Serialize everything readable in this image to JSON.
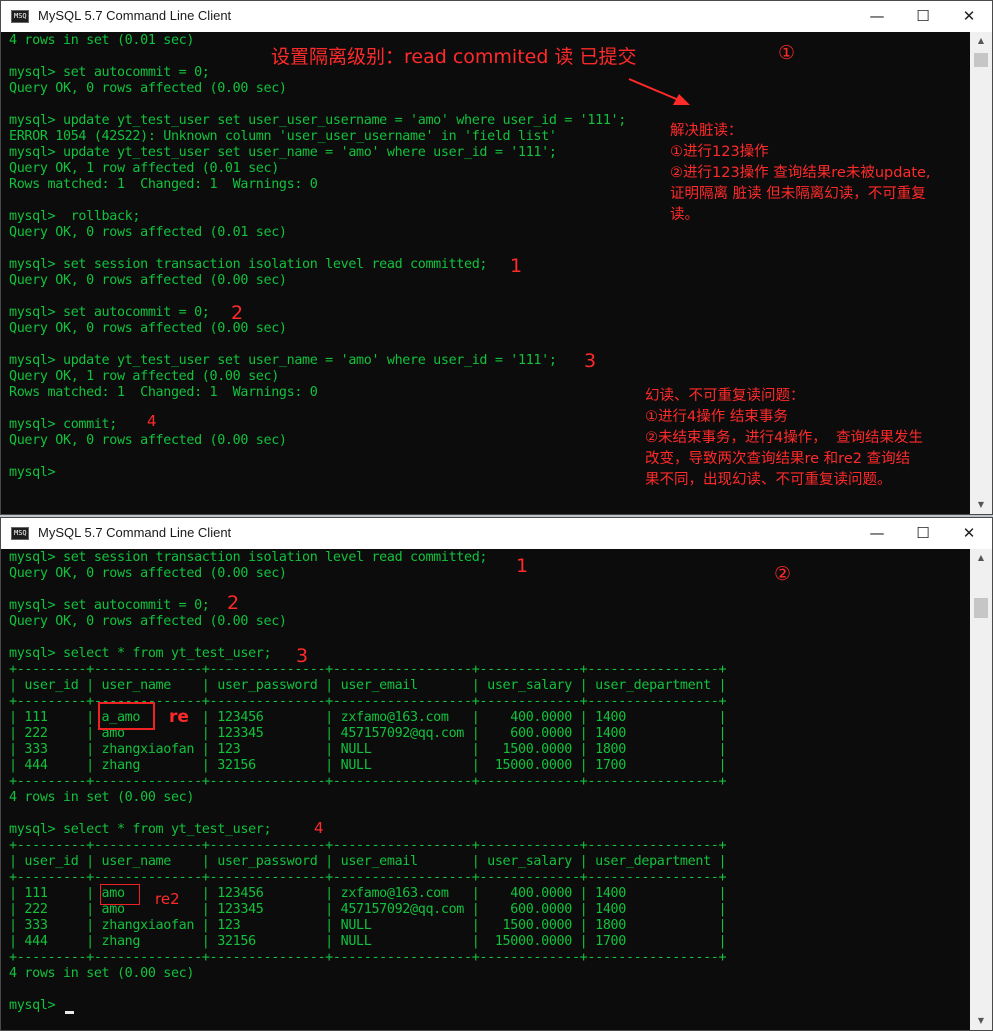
{
  "colors": {
    "terminal_bg": "#0c0c0c",
    "terminal_text": "#13c13c",
    "annotation": "#ff2a2a"
  },
  "window1": {
    "title": "MySQL 5.7 Command Line Client",
    "icon": "mysql-console-icon",
    "icon_text": "MSQ",
    "lines": [
      "4 rows in set (0.01 sec)",
      "",
      "mysql> set autocommit = 0;",
      "Query OK, 0 rows affected (0.00 sec)",
      "",
      "mysql> update yt_test_user set user_user_username = 'amo' where user_id = '111';",
      "ERROR 1054 (42S22): Unknown column 'user_user_username' in 'field list'",
      "mysql> update yt_test_user set user_name = 'amo' where user_id = '111';",
      "Query OK, 1 row affected (0.01 sec)",
      "Rows matched: 1  Changed: 1  Warnings: 0",
      "",
      "mysql>  rollback;",
      "Query OK, 0 rows affected (0.01 sec)",
      "",
      "mysql> set session transaction isolation level read committed;",
      "Query OK, 0 rows affected (0.00 sec)",
      "",
      "mysql> set autocommit = 0;",
      "Query OK, 0 rows affected (0.00 sec)",
      "",
      "mysql> update yt_test_user set user_name = 'amo' where user_id = '111';",
      "Query OK, 1 row affected (0.00 sec)",
      "Rows matched: 1  Changed: 1  Warnings: 0",
      "",
      "mysql> commit;",
      "Query OK, 0 rows affected (0.00 sec)",
      "",
      "mysql>"
    ],
    "heading": "设置隔离级别：read commited 读 已提交",
    "circle_label": "①",
    "note_dirty": "解决脏读：\n①进行123操作\n②进行123操作 查询结果re未被update,\n证明隔离 脏读 但未隔离幻读，不可重复\n读。",
    "note_phantom": "幻读、不可重复读问题：\n①进行4操作 结束事务\n②未结束事务，进行4操作，  查询结果发生\n改变，导致两次查询结果re 和re2 查询结\n果不同，出现幻读、不可重复读问题。",
    "step_1": "1",
    "step_2": "2",
    "step_3": "3",
    "step_4": "4"
  },
  "window2": {
    "title": "MySQL 5.7 Command Line Client",
    "icon": "mysql-console-icon",
    "icon_text": "MSQ",
    "lines": [
      "mysql> set session transaction isolation level read committed;",
      "Query OK, 0 rows affected (0.00 sec)",
      "",
      "mysql> set autocommit = 0;",
      "Query OK, 0 rows affected (0.00 sec)",
      "",
      "mysql> select * from yt_test_user;",
      "+---------+--------------+---------------+------------------+-------------+-----------------+",
      "| user_id | user_name    | user_password | user_email       | user_salary | user_department |",
      "+---------+--------------+---------------+------------------+-------------+-----------------+",
      "| 111     | a_amo        | 123456        | zxfamo@163.com   |    400.0000 | 1400            |",
      "| 222     | amo          | 123345        | 457157092@qq.com |    600.0000 | 1400            |",
      "| 333     | zhangxiaofan | 123           | NULL             |   1500.0000 | 1800            |",
      "| 444     | zhang        | 32156         | NULL             |  15000.0000 | 1700            |",
      "+---------+--------------+---------------+------------------+-------------+-----------------+",
      "4 rows in set (0.00 sec)",
      "",
      "mysql> select * from yt_test_user;",
      "+---------+--------------+---------------+------------------+-------------+-----------------+",
      "| user_id | user_name    | user_password | user_email       | user_salary | user_department |",
      "+---------+--------------+---------------+------------------+-------------+-----------------+",
      "| 111     | amo          | 123456        | zxfamo@163.com   |    400.0000 | 1400            |",
      "| 222     | amo          | 123345        | 457157092@qq.com |    600.0000 | 1400            |",
      "| 333     | zhangxiaofan | 123           | NULL             |   1500.0000 | 1800            |",
      "| 444     | zhang        | 32156         | NULL             |  15000.0000 | 1700            |",
      "+---------+--------------+---------------+------------------+-------------+-----------------+",
      "4 rows in set (0.00 sec)",
      "",
      "mysql>"
    ],
    "circle_label": "②",
    "label_re": "re",
    "label_re2": "re2",
    "step_1": "1",
    "step_2": "2",
    "step_3": "3",
    "step_4": "4"
  }
}
